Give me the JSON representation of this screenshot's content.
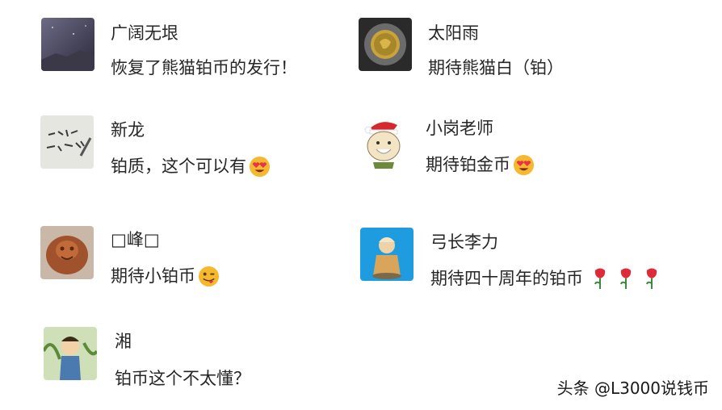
{
  "comments": [
    {
      "name": "广阔无垠",
      "text": "恢复了熊猫铂币的发行！",
      "avatar": "night-sky-avatar"
    },
    {
      "name": "太阳雨",
      "text": "期待熊猫白（铂）",
      "avatar": "gold-coin-avatar"
    },
    {
      "name": "新龙",
      "text": "铂质，这个可以有",
      "avatar": "calligraphy-avatar",
      "emoji": "heart-eyes-emoji"
    },
    {
      "name": "小岗老师",
      "text": "期待铂金币",
      "avatar": "cartoon-kid-santa-hat-avatar",
      "emoji": "heart-eyes-emoji"
    },
    {
      "name": "□峰□",
      "text": "期待小铂币",
      "avatar": "carved-figure-avatar",
      "emoji": "winking-tongue-emoji"
    },
    {
      "name": "弓长李力",
      "text": "期待四十周年的铂币",
      "avatar": "cartoon-figure-blue-avatar",
      "emoji": "rose-emoji"
    },
    {
      "name": "湘",
      "text": "铂币这个不太懂？",
      "avatar": "cartoon-boy-avatar"
    }
  ],
  "watermark": "头条 @L3000说钱币",
  "colors": {
    "text": "#262626",
    "background": "#ffffff",
    "heart": "#e8334a",
    "emoji_face": "#f5b82e"
  }
}
